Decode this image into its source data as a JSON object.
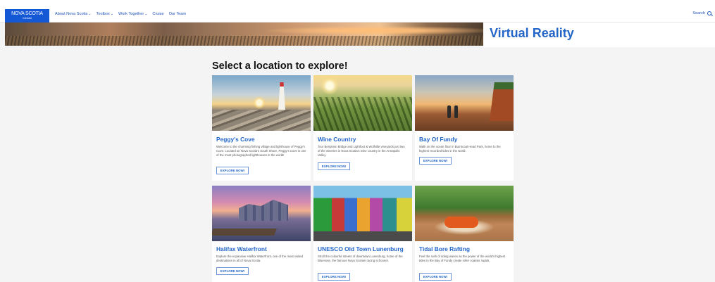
{
  "nav": {
    "logo_text": "NOVA SCOTIA",
    "logo_sub": "CANADA",
    "items": [
      {
        "label": "About Nova Scotia",
        "has_chevron": true
      },
      {
        "label": "Toolbox",
        "has_chevron": true
      },
      {
        "label": "Work Together",
        "has_chevron": true
      },
      {
        "label": "Cruise",
        "has_chevron": false
      },
      {
        "label": "Our Team",
        "has_chevron": false
      }
    ],
    "search_label": "Search",
    "search_icon": "search-icon"
  },
  "hero": {
    "title": "Virtual Reality"
  },
  "section_title": "Select a location to explore!",
  "cards": [
    {
      "title": "Peggy's Cove",
      "description": "Welcome to the charming fishing village and lighthouse of Peggy's Cove. Located on Nova Scotia's South Shore, Peggy's Cove is one of the most photographed lighthouses in the world!",
      "button": "EXPLORE NOW!"
    },
    {
      "title": "Wine Country",
      "description": "Tour Benjamin Bridge and Lightfoot & Wolfville vineyards just two of the wineries in Nova Scotia's wine country in the Annapolis Valley.",
      "button": "EXPLORE NOW!"
    },
    {
      "title": "Bay Of Fundy",
      "description": "Walk on the ocean floor in Burntcoat Head Park, home to the highest recorded tides in the world.",
      "button": "EXPLORE NOW!"
    },
    {
      "title": "Halifax Waterfront",
      "description": "Explore the expansive Halifax Waterfront, one of the most visited destinations in all of Nova Scotia.",
      "button": "EXPLORE NOW!"
    },
    {
      "title": "UNESCO Old Town Lunenburg",
      "description": "Stroll the colourful streets of downtown Lunenburg, home of the Bluenose, the famous Nova Scotian racing schooner.",
      "button": "EXPLORE NOW!"
    },
    {
      "title": "Tidal Bore Rafting",
      "description": "Feel the rush of riding waves as the power of the world's highest tides in the Bay of Fundy create roller coaster rapids.",
      "button": "EXPLORE NOW!"
    }
  ],
  "colors": {
    "brand_blue": "#1558d6",
    "link_blue": "#2366c7",
    "background": "#f4f4f4"
  }
}
